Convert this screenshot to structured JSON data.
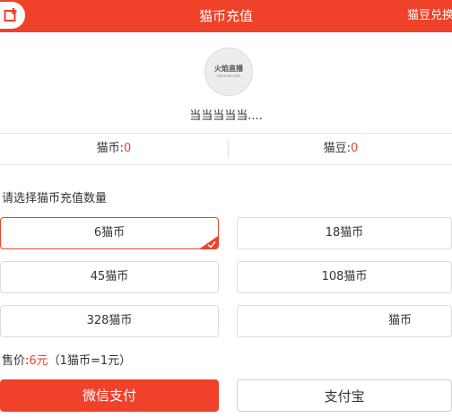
{
  "header": {
    "title": "猫币充值",
    "right_label": "猫豆兑换",
    "bg_color": "#f0412a"
  },
  "profile": {
    "avatar_logo_text": "火焰直播",
    "avatar_logo_sub": "Huomao.com",
    "username": "当当当当当...."
  },
  "balance": {
    "coin_label": "猫币:",
    "coin_value": "0",
    "bean_label": "猫豆:",
    "bean_value": "0"
  },
  "recharge": {
    "prompt": "请选择猫币充值数量",
    "options": [
      {
        "label": "6猫币",
        "selected": true
      },
      {
        "label": "18猫币",
        "selected": false
      },
      {
        "label": "45猫币",
        "selected": false
      },
      {
        "label": "108猫币",
        "selected": false
      },
      {
        "label": "328猫币",
        "selected": false
      },
      {
        "label": "猫币",
        "selected": false
      }
    ]
  },
  "price": {
    "prefix": "售价:",
    "amount": "6元",
    "rate": "（1猫币=1元）"
  },
  "payment": {
    "wechat_label": "微信支付",
    "alipay_label": "支付宝"
  },
  "colors": {
    "accent": "#f0412a",
    "border": "#dcdcdc",
    "text": "#333333"
  }
}
